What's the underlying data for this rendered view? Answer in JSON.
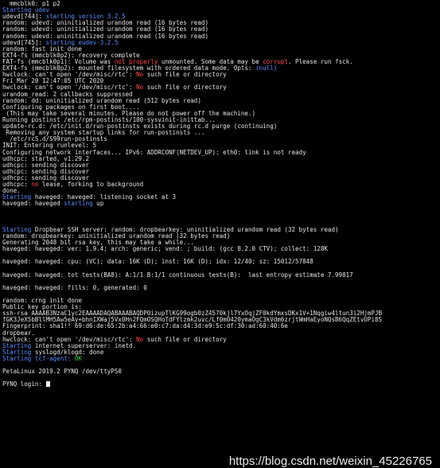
{
  "colors": {
    "background": "#000000",
    "default_text": "#e6e6e6",
    "blue": "#5c8cff",
    "red": "#ff4d4d",
    "green": "#33d14c"
  },
  "terminal": {
    "lines": [
      [
        {
          "t": "  mmcblk0: p1 p2",
          "c": "default"
        }
      ],
      [
        {
          "t": "Starting udev",
          "c": "blue"
        }
      ],
      [
        {
          "t": "udevd[744]: ",
          "c": "default"
        },
        {
          "t": "starting version 3.2.5",
          "c": "blue"
        }
      ],
      [
        {
          "t": "random: udevd: uninitialized urandom read (16 bytes read)",
          "c": "default"
        }
      ],
      [
        {
          "t": "random: udevd: uninitialized urandom read (16 bytes read)",
          "c": "default"
        }
      ],
      [
        {
          "t": "random: udevd: uninitialized urandom read (16 bytes read)",
          "c": "default"
        }
      ],
      [
        {
          "t": "udevd[745]: ",
          "c": "default"
        },
        {
          "t": "starting eudev-3.2.5",
          "c": "blue"
        }
      ],
      [
        {
          "t": "random: fast init done",
          "c": "default"
        }
      ],
      [
        {
          "t": "EXT4-fs (mmcblk0p2): recovery complete",
          "c": "default"
        }
      ],
      [
        {
          "t": "FAT-fs (mmcblk0p1): Volume was ",
          "c": "default"
        },
        {
          "t": "not properly",
          "c": "red"
        },
        {
          "t": " unmounted. Some data may be ",
          "c": "default"
        },
        {
          "t": "corrupt",
          "c": "red"
        },
        {
          "t": ". Please run fsck.",
          "c": "default"
        }
      ],
      [
        {
          "t": "EXT4-fs (mmcblk0p2): mounted filesystem with ordered data mode. Opts: ",
          "c": "default"
        },
        {
          "t": "(null)",
          "c": "blue"
        }
      ],
      [
        {
          "t": "hwclock: can't open '/dev/misc/rtc': ",
          "c": "default"
        },
        {
          "t": "No",
          "c": "red"
        },
        {
          "t": " such file or directory",
          "c": "default"
        }
      ],
      [
        {
          "t": "Fri Mar 20 12:47:05 UTC 2020",
          "c": "default"
        }
      ],
      [
        {
          "t": "hwclock: can't open '/dev/misc/rtc': ",
          "c": "default"
        },
        {
          "t": "No",
          "c": "red"
        },
        {
          "t": " such file or directory",
          "c": "default"
        }
      ],
      [
        {
          "t": "urandom_read: 2 callbacks suppressed",
          "c": "default"
        }
      ],
      [
        {
          "t": "random: dd: uninitialized urandom read (512 bytes read)",
          "c": "default"
        }
      ],
      [
        {
          "t": "Configuring packages on first boot....",
          "c": "default"
        }
      ],
      [
        {
          "t": " (This may take several minutes. Please do not power off the machine.)",
          "c": "default"
        }
      ],
      [
        {
          "t": "Running postinst /etc/rpm-postinsts/100-sysvinit-inittab...",
          "c": "default"
        }
      ],
      [
        {
          "t": "update-rc.d: /etc/init.d/run-postinsts exists during rc.d purge (continuing)",
          "c": "default"
        }
      ],
      [
        {
          "t": " Removing any system startup links for run-postinsts ...",
          "c": "default"
        }
      ],
      [
        {
          "t": "  /etc/rcS.d/S99run-postinsts",
          "c": "default"
        }
      ],
      [
        {
          "t": "INIT: Entering runlevel: 5",
          "c": "default"
        }
      ],
      [
        {
          "t": "Configuring network interfaces... IPv6: ADDRCONF(NETDEV_UP): eth0: link is not ready",
          "c": "default"
        }
      ],
      [
        {
          "t": "udhcpc: started, v1.29.2",
          "c": "default"
        }
      ],
      [
        {
          "t": "udhcpc: sending discover",
          "c": "default"
        }
      ],
      [
        {
          "t": "udhcpc: sending discover",
          "c": "default"
        }
      ],
      [
        {
          "t": "udhcpc: sending discover",
          "c": "default"
        }
      ],
      [
        {
          "t": "udhcpc: ",
          "c": "default"
        },
        {
          "t": "no",
          "c": "red"
        },
        {
          "t": " lease, forking to background",
          "c": "default"
        }
      ],
      [
        {
          "t": "done.",
          "c": "default"
        }
      ],
      [
        {
          "t": "Starting",
          "c": "blue"
        },
        {
          "t": " haveged: haveged: listening socket at 3",
          "c": "default"
        }
      ],
      [
        {
          "t": "haveged: haveged ",
          "c": "default"
        },
        {
          "t": "starting",
          "c": "blue"
        },
        {
          "t": " up",
          "c": "default"
        }
      ],
      [],
      [],
      [],
      [
        {
          "t": "Starting",
          "c": "blue"
        },
        {
          "t": " Dropbear SSH server: random: dropbearkey: uninitialized urandom read (32 bytes read)",
          "c": "default"
        }
      ],
      [
        {
          "t": "random: dropbearkey: uninitialized urandom read (32 bytes read)",
          "c": "default"
        }
      ],
      [
        {
          "t": "Generating 2048 bit rsa key, this may take a while...",
          "c": "default"
        }
      ],
      [
        {
          "t": "haveged: haveged: ver: 1.9.4; arch: generic; vend: ; build: (gcc 8.2.0 CTV); collect: 128K",
          "c": "default"
        }
      ],
      [],
      [
        {
          "t": "haveged: haveged: cpu: (VC); data: 16K (D); inst: 16K (D); idx: 12/40; sz: 15012/57848",
          "c": "default"
        }
      ],
      [],
      [
        {
          "t": "haveged: haveged: tot tests(BA8): A:1/1 B:1/1 continuous tests(B):  last entropy estimate 7.99817",
          "c": "default"
        }
      ],
      [],
      [
        {
          "t": "haveged: haveged: fills: 0, generated: 0",
          "c": "default"
        }
      ],
      [],
      [
        {
          "t": "random: crng init done",
          "c": "default"
        }
      ],
      [
        {
          "t": "Public key portion is:",
          "c": "default"
        }
      ],
      [
        {
          "t": "ssh-rsa AAAAB3NzaC1yc2EAAAADAQABAAABAQDP0izupTlKG99ogb0zZ4570kjl7YxOqjZF0kdYmxsDKx1V+1Nqgiw4ltun3i2HjmPJB",
          "c": "default"
        }
      ],
      [
        {
          "t": "fGK3JeX5bBllMH5Aw5eAy+bhnIXWaj5Vx0Hn2FQmOSQHoTdFYlzmk2uvc/Lf0m0420ymaOgC3kVdm6zrjtWmHaEyoNQsB6QqZEtvUPi8S",
          "c": "default"
        }
      ],
      [
        {
          "t": "Fingerprint: sha1!! 69:d6:de:65:2b:a4:66:e0:c7:da:d4:3d:e9:5c:df:30:ad:60:40:6e",
          "c": "default"
        }
      ],
      [
        {
          "t": "dropbear.",
          "c": "default"
        }
      ],
      [
        {
          "t": "hwclock: can't open '/dev/misc/rtc': ",
          "c": "default"
        },
        {
          "t": "No",
          "c": "red"
        },
        {
          "t": " such file or directory",
          "c": "default"
        }
      ],
      [
        {
          "t": "Starting",
          "c": "blue"
        },
        {
          "t": " internet superserver: inetd.",
          "c": "default"
        }
      ],
      [
        {
          "t": "Starting",
          "c": "blue"
        },
        {
          "t": " syslogd/klogd: done",
          "c": "default"
        }
      ],
      [
        {
          "t": "Starting tcf-agent: ",
          "c": "blue"
        },
        {
          "t": "OK",
          "c": "green"
        }
      ],
      [],
      [
        {
          "t": "PetaLinux 2019.2 PYNQ /dev/ttyPS0",
          "c": "default"
        }
      ],
      [],
      [
        {
          "t": "PYNQ login: ",
          "c": "default"
        }
      ]
    ]
  },
  "watermark": {
    "text": "https://blog.csdn.net/weixin_45226765"
  }
}
